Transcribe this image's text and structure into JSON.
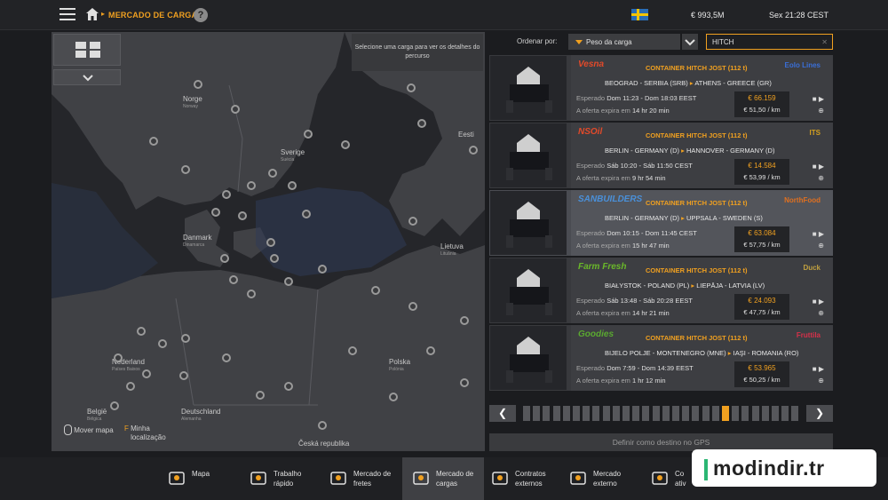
{
  "topbar": {
    "breadcrumb": "MERCADO DE CARGAS",
    "help": "?",
    "money": "€ 993,5M",
    "clock": "Sex 21:28 CEST"
  },
  "map": {
    "tip": "Selecione uma carga para ver os detalhes do percurso",
    "labels": {
      "norge": "Norge",
      "norge_sub": "Norway",
      "sverige": "Sverige",
      "sverige_sub": "Suécia",
      "eesti": "Eesti",
      "danmark": "Danmark",
      "danmark_sub": "Dinamarca",
      "lietuva": "Lietuva",
      "lietuva_sub": "Lituânia",
      "nederland": "Nederland",
      "nederland_sub": "Países Baixos",
      "polska": "Polska",
      "polska_sub": "Polónia",
      "belgie": "België",
      "belgie_sub": "Bélgica",
      "deutschland": "Deutschland",
      "deutschland_sub": "Alemanha",
      "cesko": "Česká republika"
    },
    "move_map": "Mover mapa",
    "my_location_1": "Minha",
    "my_location_2": "localização"
  },
  "sort": {
    "label": "Ordenar por:",
    "value": "Peso da carga",
    "search_value": "HITCH"
  },
  "cards": [
    {
      "company": "Vesna",
      "company_color": "#e34a2a",
      "partner": "Eolo Lines",
      "partner_color": "#3a6fd8",
      "cargo": "CONTAINER HITCH JOST (112 t)",
      "from": "BEOGRAD - SERBIA (SRB)",
      "to": "ATHENS - GREECE (GR)",
      "esperado_label": "Esperado",
      "esperado": "Dom 11:23 - Dom 18:03 EEST",
      "expira_label": "A oferta expira em",
      "expira": "14 hr 20 min",
      "price": "€ 66.159",
      "per_km": "€ 51,50 / km"
    },
    {
      "company": "NSOil",
      "company_color": "#e34a2a",
      "partner": "ITS",
      "partner_color": "#d4a020",
      "cargo": "CONTAINER HITCH JOST (112 t)",
      "from": "BERLIN - GERMANY (D)",
      "to": "HANNOVER - GERMANY (D)",
      "esperado_label": "Esperado",
      "esperado": "Sáb 10:20 - Sáb 11:50 CEST",
      "expira_label": "A oferta expira em",
      "expira": "9 hr 54 min",
      "price": "€ 14.584",
      "per_km": "€ 53,99 / km"
    },
    {
      "company": "SANBUILDERS",
      "company_color": "#4a90d9",
      "partner": "NorthFood",
      "partner_color": "#e07020",
      "cargo": "CONTAINER HITCH JOST (112 t)",
      "from": "BERLIN - GERMANY (D)",
      "to": "UPPSALA - SWEDEN (S)",
      "esperado_label": "Esperado",
      "esperado": "Dom 10:15 - Dom 11:45 CEST",
      "expira_label": "A oferta expira em",
      "expira": "15 hr 47 min",
      "price": "€ 63.084",
      "per_km": "€ 57,75 / km"
    },
    {
      "company": "Farm Fresh",
      "company_color": "#6ab82a",
      "partner": "Duck",
      "partner_color": "#c0a040",
      "cargo": "CONTAINER HITCH JOST (112 t)",
      "from": "BIAŁYSTOK - POLAND (PL)",
      "to": "LIEPĀJA - LATVIA (LV)",
      "esperado_label": "Esperado",
      "esperado": "Sáb 13:48 - Sáb 20:28 EEST",
      "expira_label": "A oferta expira em",
      "expira": "14 hr 21 min",
      "price": "€ 24.093",
      "per_km": "€ 47,75 / km"
    },
    {
      "company": "Goodies",
      "company_color": "#5aa830",
      "partner": "Fruttila",
      "partner_color": "#d8304a",
      "cargo": "CONTAINER HITCH JOST (112 t)",
      "from": "BIJELO POLJE - MONTENEGRO (MNE)",
      "to": "IAŞI - ROMANIA (RO)",
      "esperado_label": "Esperado",
      "esperado": "Dom 7:59 - Dom 14:39 EEST",
      "expira_label": "A oferta expira em",
      "expira": "1 hr 12 min",
      "price": "€ 53.965",
      "per_km": "€ 50,25 / km"
    }
  ],
  "pager": {
    "segments": 28,
    "current": 20
  },
  "gps_button": "Definir como destino no GPS",
  "bottom_tabs": [
    {
      "l1": "Mapa",
      "l2": ""
    },
    {
      "l1": "Trabalho",
      "l2": "rápido"
    },
    {
      "l1": "Mercado de",
      "l2": "fretes"
    },
    {
      "l1": "Mercado de",
      "l2": "cargas"
    },
    {
      "l1": "Contratos",
      "l2": "externos"
    },
    {
      "l1": "Mercado",
      "l2": "externo"
    },
    {
      "l1": "Co",
      "l2": "ativ"
    }
  ],
  "watermark": "modindir.tr",
  "colors": {
    "accent": "#f0a020"
  }
}
